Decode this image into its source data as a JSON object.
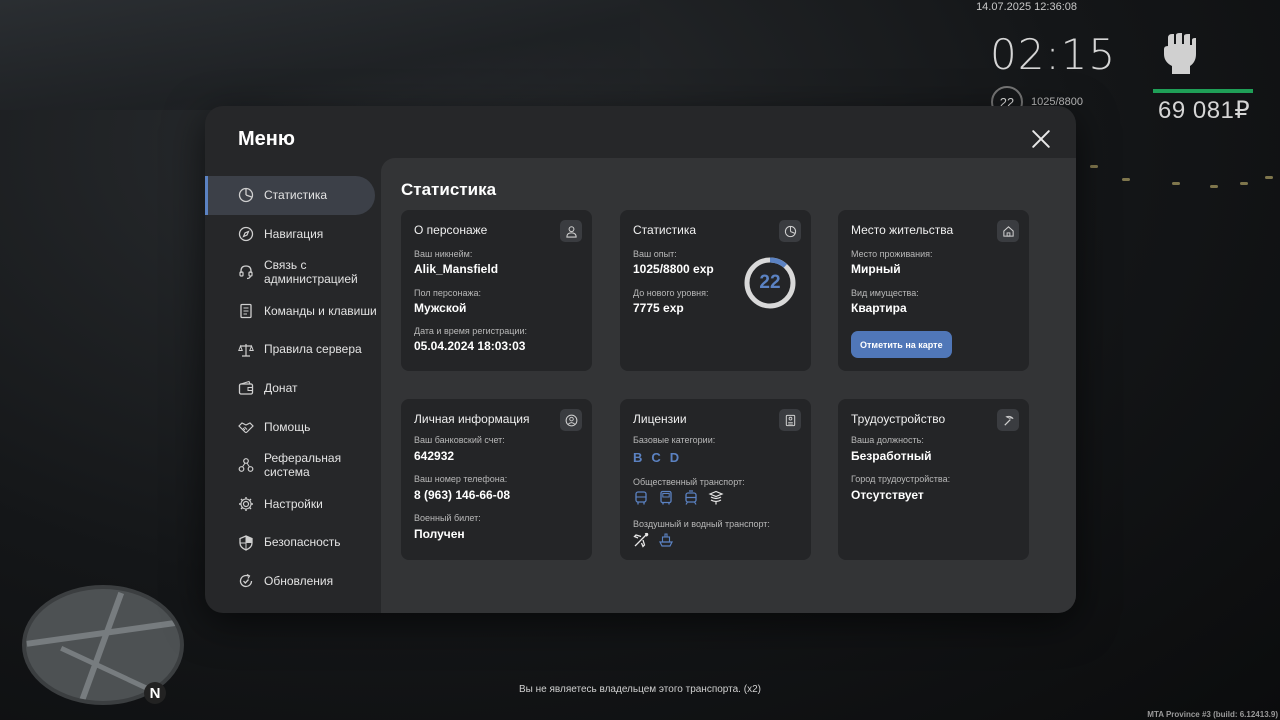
{
  "hud": {
    "datetime": "14.07.2025 12:36:08",
    "clock": "02:15",
    "level": "22",
    "exp": "1025/8800",
    "money": "69 081₽",
    "health_color": "#1f9f57"
  },
  "menu": {
    "title": "Меню",
    "close_icon": "close-icon",
    "sidebar": [
      {
        "label": "Статистика",
        "icon": "chart-pie-icon",
        "active": true
      },
      {
        "label": "Навигация",
        "icon": "compass-icon"
      },
      {
        "label": "Связь с администрацией",
        "icon": "headset-icon"
      },
      {
        "label": "Команды и клавиши",
        "icon": "document-icon"
      },
      {
        "label": "Правила сервера",
        "icon": "scales-icon"
      },
      {
        "label": "Донат",
        "icon": "wallet-icon"
      },
      {
        "label": "Помощь",
        "icon": "handshake-icon"
      },
      {
        "label": "Реферальная система",
        "icon": "network-icon"
      },
      {
        "label": "Настройки",
        "icon": "gear-icon"
      },
      {
        "label": "Безопасность",
        "icon": "shield-icon"
      },
      {
        "label": "Обновления",
        "icon": "refresh-check-icon"
      }
    ],
    "content_title": "Статистика",
    "cards": {
      "character": {
        "title": "О персонаже",
        "icon": "user-icon",
        "nickname_label": "Ваш никнейм:",
        "nickname": "Alik_Mansfield",
        "gender_label": "Пол персонажа:",
        "gender": "Мужской",
        "reg_label": "Дата и время регистрации:",
        "reg_date": "05.04.2024 18:03:03"
      },
      "stats": {
        "title": "Статистика",
        "icon": "chart-pie-icon",
        "exp_label": "Ваш опыт:",
        "exp": "1025/8800 exp",
        "next_label": "До нового уровня:",
        "next": "7775 exp",
        "level": "22",
        "progress": 0.1165,
        "accent": "#5b82c2"
      },
      "residence": {
        "title": "Место жительства",
        "icon": "house-icon",
        "place_label": "Место проживания:",
        "place": "Мирный",
        "property_label": "Вид имущества:",
        "property": "Квартира",
        "button": "Отметить на карте"
      },
      "personal": {
        "title": "Личная информация",
        "icon": "user-circle-icon",
        "bank_label": "Ваш банковский счет:",
        "bank": "642932",
        "phone_label": "Ваш номер телефона:",
        "phone": "8 (963) 146-66-08",
        "military_label": "Военный билет:",
        "military": "Получен"
      },
      "licenses": {
        "title": "Лицензии",
        "icon": "id-card-icon",
        "base_label": "Базовые категории:",
        "categories": [
          "B",
          "C",
          "D"
        ],
        "public_label": "Общественный транспорт:",
        "public_icons": [
          "bus-icon",
          "bus-icon",
          "tram-icon",
          "trolley-icon"
        ],
        "air_label": "Воздушный и водный транспорт:",
        "air_icons": [
          "airplane-icon",
          "ship-icon"
        ]
      },
      "job": {
        "title": "Трудоустройство",
        "icon": "pickaxe-icon",
        "position_label": "Ваша должность:",
        "position": "Безработный",
        "city_label": "Город трудоустройства:",
        "city": "Отсутствует"
      }
    }
  },
  "notice": "Вы не являетесь владельцем этого транспорта. (x2)",
  "build": "MTA Province #3 (build: 6.12413.9)"
}
